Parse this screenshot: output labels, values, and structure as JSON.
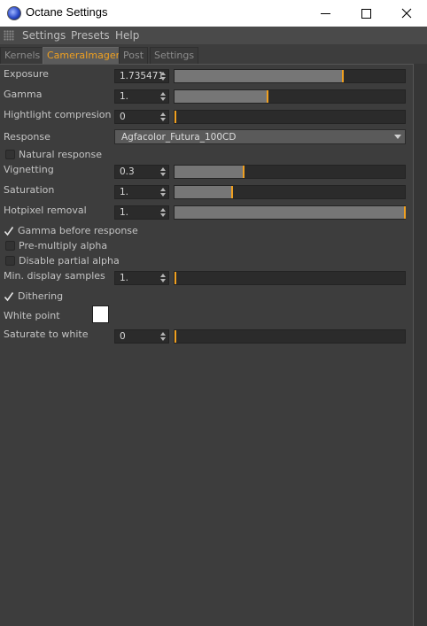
{
  "window": {
    "title": "Octane Settings",
    "app_icon": "cinema4d-icon",
    "controls": [
      "minimize-icon",
      "maximize-icon",
      "close-icon"
    ]
  },
  "menu": {
    "items": [
      "Settings",
      "Presets",
      "Help"
    ]
  },
  "tabs": [
    {
      "label": "Kernels",
      "active": false
    },
    {
      "label": "CameraImager",
      "active": true
    },
    {
      "label": "Post",
      "active": false
    },
    {
      "label": "Settings",
      "active": false
    }
  ],
  "params": {
    "exposure": {
      "label": "Exposure",
      "value": "1.735471",
      "level": 0.73
    },
    "gamma": {
      "label": "Gamma",
      "value": "1.",
      "level": 0.405
    },
    "highlight": {
      "label": "Hightlight compresion",
      "value": "0",
      "level": 0.0
    },
    "response": {
      "label": "Response",
      "value": "Agfacolor_Futura_100CD"
    },
    "natural_response": {
      "label": "Natural response",
      "checked": false
    },
    "vignetting": {
      "label": "Vignetting",
      "value": "0.3",
      "level": 0.3
    },
    "saturation": {
      "label": "Saturation",
      "value": "1.",
      "level": 0.25
    },
    "hotpixel": {
      "label": "Hotpixel removal",
      "value": "1.",
      "level": 1.0
    },
    "gamma_before_response": {
      "label": "Gamma before response",
      "checked": true
    },
    "premultiply_alpha": {
      "label": "Pre-multiply alpha",
      "checked": false
    },
    "disable_partial_alpha": {
      "label": "Disable partial alpha",
      "checked": false
    },
    "min_display_samples": {
      "label": "Min. display samples",
      "value": "1.",
      "level": 0.0
    },
    "dithering": {
      "label": "Dithering",
      "checked": true
    },
    "white_point": {
      "label": "White point",
      "color": "#ffffff"
    },
    "saturate_to_white": {
      "label": "Saturate to white",
      "value": "0",
      "level": 0.0
    }
  },
  "colors": {
    "accent": "#f0a020",
    "panel": "#3d3d3d",
    "field": "#2b2b2b"
  }
}
